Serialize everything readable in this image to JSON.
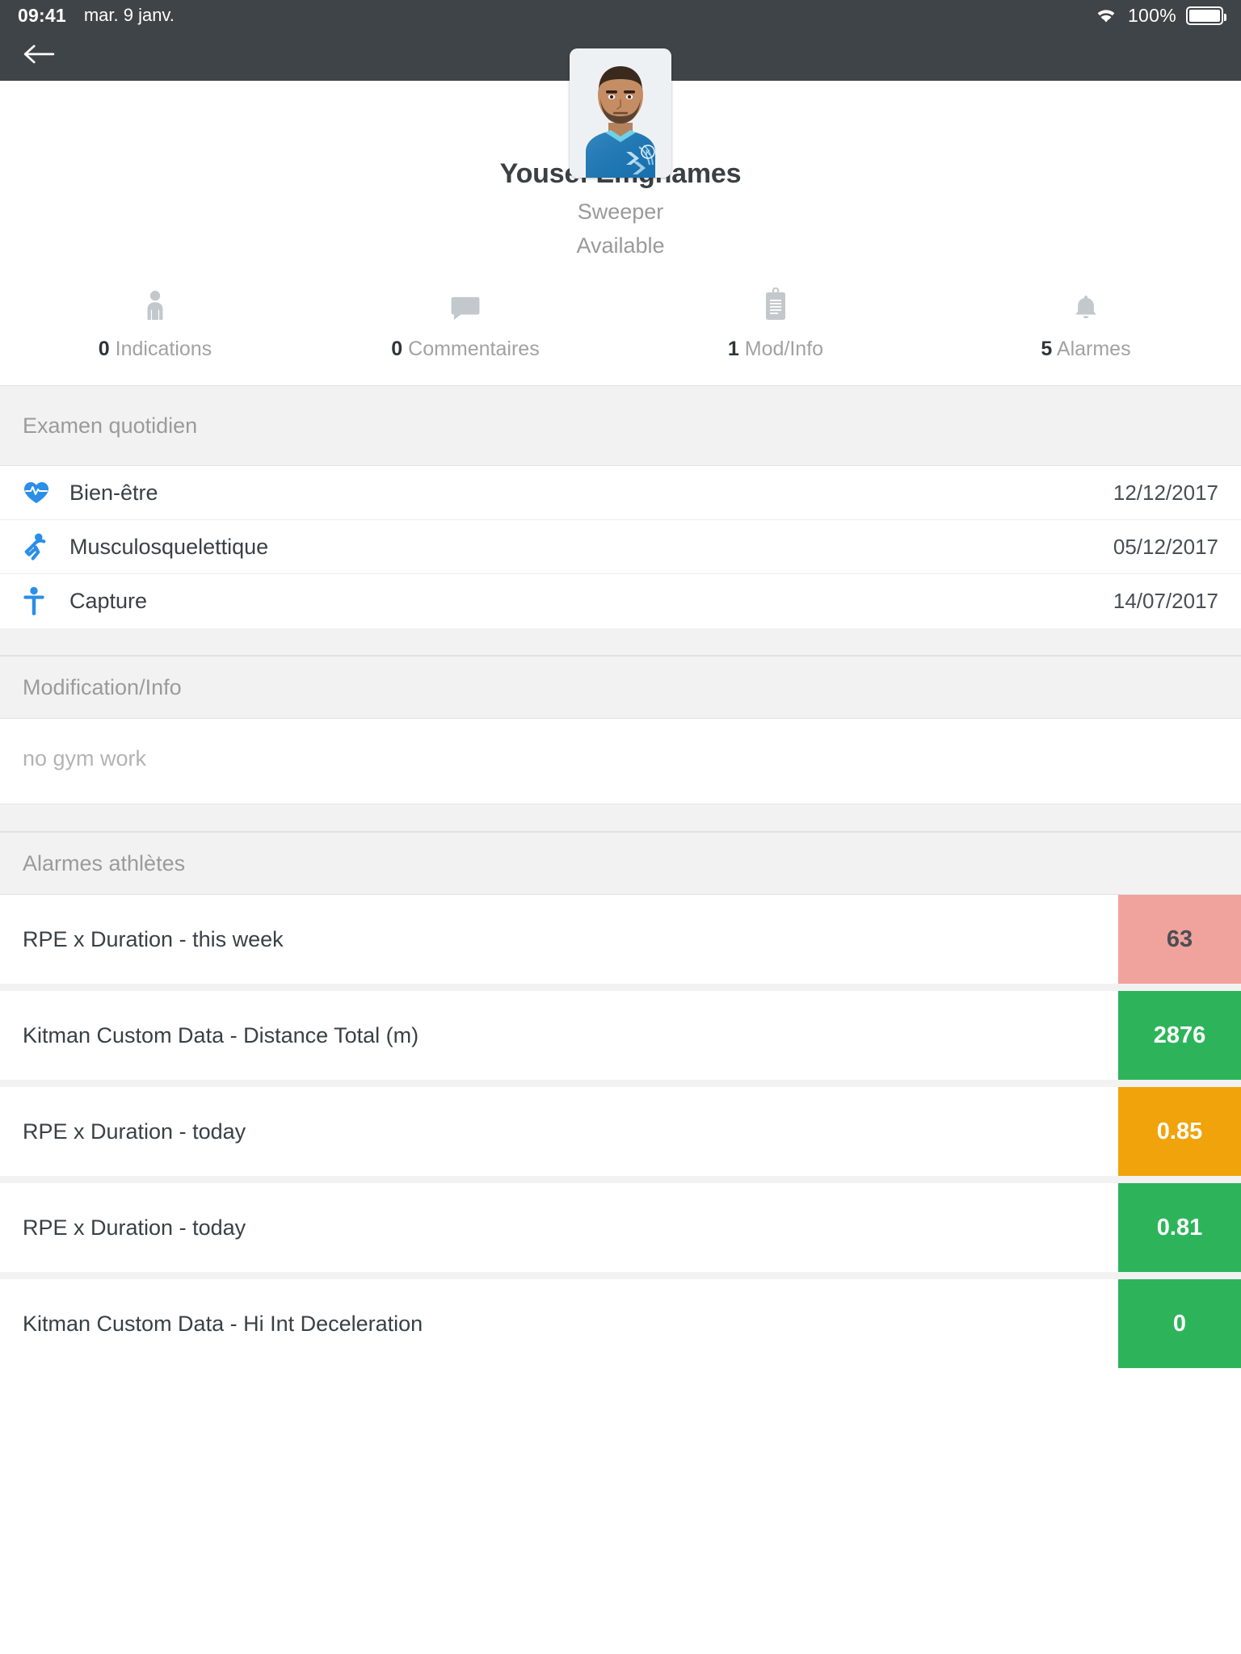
{
  "status_bar": {
    "time": "09:41",
    "date": "mar. 9 janv.",
    "battery_percent": "100%",
    "wifi_icon": "wifi-icon",
    "battery_icon": "battery-full-icon"
  },
  "navbar": {
    "back_icon": "back-arrow-icon",
    "background": "#3F4448"
  },
  "profile": {
    "avatar_icon": "athlete-photo",
    "name": "Yousef Emghames",
    "role": "Sweeper",
    "status": "Available",
    "stats": [
      {
        "count": "0",
        "label": "Indications",
        "icon": "person-icon"
      },
      {
        "count": "0",
        "label": "Commentaires",
        "icon": "comment-bubble-icon"
      },
      {
        "count": "1",
        "label": "Mod/Info",
        "icon": "clipboard-icon"
      },
      {
        "count": "5",
        "label": "Alarmes",
        "icon": "bell-icon"
      }
    ]
  },
  "examen": {
    "title": "Examen quotidien",
    "rows": [
      {
        "label": "Bien-être",
        "date": "12/12/2017",
        "icon": "heart-pulse-icon"
      },
      {
        "label": "Musculosquelettique",
        "date": "05/12/2017",
        "icon": "running-person-icon"
      },
      {
        "label": "Capture",
        "date": "14/07/2017",
        "icon": "standing-person-icon"
      }
    ]
  },
  "modification": {
    "title": "Modification/Info",
    "note": "no gym work"
  },
  "alarms": {
    "title": "Alarmes athlètes",
    "rows": [
      {
        "label": "RPE x Duration - this week",
        "value": "63",
        "color": "#F0A29D",
        "text_color": "#4a4f54"
      },
      {
        "label": "Kitman Custom Data - Distance Total (m)",
        "value": "2876",
        "color": "#2DB45A",
        "text_color": "#ffffff"
      },
      {
        "label": "RPE x Duration - today",
        "value": "0.85",
        "color": "#F0A30A",
        "text_color": "#ffffff"
      },
      {
        "label": "RPE x Duration - today",
        "value": "0.81",
        "color": "#2DB45A",
        "text_color": "#ffffff"
      },
      {
        "label": "Kitman Custom Data - Hi Int Deceleration",
        "value": "0",
        "color": "#2DB45A",
        "text_color": "#ffffff"
      }
    ]
  },
  "theme": {
    "icon_blue": "#2B8EE8",
    "header_dark": "#3F4448",
    "section_grey": "#F2F2F2"
  }
}
